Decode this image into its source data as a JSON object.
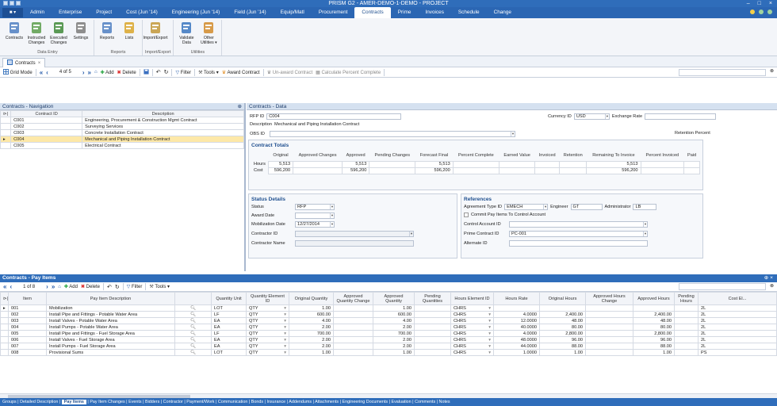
{
  "window": {
    "title": "PRISM G2 - AMER-DEMO-1-DEMO - PROJECT",
    "min": "–",
    "max": "□",
    "close": "×"
  },
  "menu": {
    "file_label": "■ ▾",
    "tabs": [
      "Admin",
      "Enterprise",
      "Project",
      "Cost (Jun '14)",
      "Engineering (Jun '14)",
      "Field (Jun '14)",
      "Equip/Matl",
      "Procurement",
      "Contracts",
      "Prime",
      "Invoices",
      "Schedule",
      "Change"
    ],
    "active_tab": "Contracts"
  },
  "ribbon": {
    "groups": [
      {
        "label": "Data Entry",
        "buttons": [
          "Contracts",
          "Instructed Changes",
          "Executed Changes",
          "Settings"
        ]
      },
      {
        "label": "Reports",
        "buttons": [
          "Reports",
          "Lists"
        ]
      },
      {
        "label": "Import/Export",
        "buttons": [
          "Import/Export"
        ]
      },
      {
        "label": "Utilities",
        "buttons": [
          "Validate Data",
          "Other Utilities ▾"
        ]
      }
    ]
  },
  "doc_tab": {
    "label": "Contracts",
    "close": "×"
  },
  "toolbar": {
    "grid_mode": "Grid Mode",
    "record": "4 of 5",
    "add": "Add",
    "delete": "Delete",
    "filter": "Filter",
    "tools": "Tools ▾",
    "award": "Award Contract",
    "unaward": "Un-award Contract",
    "calc": "Calculate Percent Complete"
  },
  "nav": {
    "title": "Contracts - Navigation",
    "pin": "⊕",
    "columns": [
      "Contract ID",
      "Description"
    ],
    "rows": [
      {
        "id": "C001",
        "desc": "Engineering, Procurement & Construction Mgmt Contract"
      },
      {
        "id": "C002",
        "desc": "Surveying Services"
      },
      {
        "id": "C003",
        "desc": "Concrete Installation Contract"
      },
      {
        "id": "C004",
        "desc": "Mechanical and Piping Installation Contract"
      },
      {
        "id": "C005",
        "desc": "Electrical Contract"
      }
    ],
    "selected_index": 3
  },
  "detail": {
    "title": "Contracts - Data",
    "rfp_label": "RFP ID",
    "rfp_value": "C004",
    "currency_label": "Currency ID",
    "currency_value": "USD",
    "exchange_label": "Exchange Rate",
    "description_label": "Description",
    "description_value": "Mechanical and Piping Installation Contract",
    "obs_label": "OBS ID",
    "retention_label": "Retention Percent",
    "totals": {
      "title": "Contract Totals",
      "columns": [
        "Original",
        "Approved Changes",
        "Approved",
        "Pending Changes",
        "Forecast Final",
        "Percent Complete",
        "Earned Value",
        "Invoiced",
        "Retention",
        "Remaining To Invoice",
        "Percent Invoiced",
        "Paid"
      ],
      "rows": [
        {
          "label": "Hours",
          "values": [
            "5,513",
            "",
            "5,513",
            "",
            "5,513",
            "",
            "",
            "",
            "",
            "5,513",
            "",
            ""
          ]
        },
        {
          "label": "Cost",
          "values": [
            "596,200",
            "",
            "596,200",
            "",
            "596,200",
            "",
            "",
            "",
            "",
            "596,200",
            "",
            ""
          ]
        }
      ]
    },
    "status": {
      "title": "Status Details",
      "status_label": "Status",
      "status_value": "RFP",
      "award_label": "Award Date",
      "mob_label": "Mobilization Date",
      "mob_value": "12/27/2014",
      "contractor_id_label": "Contractor ID",
      "contractor_name_label": "Contractor Name"
    },
    "references": {
      "title": "References",
      "agreement_label": "Agreement Type ID",
      "agreement_value": "EMECH",
      "engineer_label": "Engineer",
      "engineer_value": "GT",
      "admin_label": "Administrator",
      "admin_value": "LB",
      "commit_label": "Commit Pay Items To Control Account",
      "control_label": "Control Account ID",
      "prime_label": "Prime Contract ID",
      "prime_value": "PC-001",
      "alternate_label": "Alternate ID"
    }
  },
  "pay_items": {
    "title": "Contracts - Pay Items",
    "record": "1 of 8",
    "add": "Add",
    "delete": "Delete",
    "filter": "Filter",
    "tools": "Tools ▾",
    "columns": [
      "Item",
      "Pay Item Description",
      "Quantity Unit",
      "Quantity Element ID",
      "Original Quantity",
      "Approved Quantity Change",
      "Approved Quantity",
      "Pending Quantities",
      "Hours Element ID",
      "Hours Rate",
      "Original Hours",
      "Approved Hours Change",
      "Approved Hours",
      "Pending Hours",
      "Cost El..."
    ],
    "rows": [
      {
        "item": "001",
        "desc": "Mobilization",
        "unit": "LOT",
        "qel": "QTY",
        "oq": "1.00",
        "aqc": "",
        "aq": "1.00",
        "pq": "",
        "hel": "CHRS",
        "hr": "",
        "oh": "",
        "ahc": "",
        "ah": "",
        "ph": "",
        "cel": "2L"
      },
      {
        "item": "002",
        "desc": "Install Pipe and Fittings - Potable Water Area",
        "unit": "LF",
        "qel": "QTY",
        "oq": "600.00",
        "aqc": "",
        "aq": "600.00",
        "pq": "",
        "hel": "CHRS",
        "hr": "4.0000",
        "oh": "2,400.00",
        "ahc": "",
        "ah": "2,400.00",
        "ph": "",
        "cel": "2L"
      },
      {
        "item": "003",
        "desc": "Install Valves - Potable Water Area",
        "unit": "EA",
        "qel": "QTY",
        "oq": "4.00",
        "aqc": "",
        "aq": "4.00",
        "pq": "",
        "hel": "CHRS",
        "hr": "12.0000",
        "oh": "48.00",
        "ahc": "",
        "ah": "48.00",
        "ph": "",
        "cel": "2L"
      },
      {
        "item": "004",
        "desc": "Install Pumps - Potable Water Area",
        "unit": "EA",
        "qel": "QTY",
        "oq": "2.00",
        "aqc": "",
        "aq": "2.00",
        "pq": "",
        "hel": "CHRS",
        "hr": "40.0000",
        "oh": "80.00",
        "ahc": "",
        "ah": "80.00",
        "ph": "",
        "cel": "2L"
      },
      {
        "item": "005",
        "desc": "Install Pipe and Fittings - Fuel Storage Area",
        "unit": "LF",
        "qel": "QTY",
        "oq": "700.00",
        "aqc": "",
        "aq": "700.00",
        "pq": "",
        "hel": "CHRS",
        "hr": "4.0000",
        "oh": "2,800.00",
        "ahc": "",
        "ah": "2,800.00",
        "ph": "",
        "cel": "2L"
      },
      {
        "item": "006",
        "desc": "Install Valves - Fuel Storage Area",
        "unit": "EA",
        "qel": "QTY",
        "oq": "2.00",
        "aqc": "",
        "aq": "2.00",
        "pq": "",
        "hel": "CHRS",
        "hr": "48.0000",
        "oh": "96.00",
        "ahc": "",
        "ah": "96.00",
        "ph": "",
        "cel": "2L"
      },
      {
        "item": "007",
        "desc": "Install Pumps - Fuel Storage Area",
        "unit": "EA",
        "qel": "QTY",
        "oq": "2.00",
        "aqc": "",
        "aq": "2.00",
        "pq": "",
        "hel": "CHRS",
        "hr": "44.0000",
        "oh": "88.00",
        "ahc": "",
        "ah": "88.00",
        "ph": "",
        "cel": "2L"
      },
      {
        "item": "008",
        "desc": "Provisional Sums",
        "unit": "LOT",
        "qel": "QTY",
        "oq": "1.00",
        "aqc": "",
        "aq": "1.00",
        "pq": "",
        "hel": "CHRS",
        "hr": "1.0000",
        "oh": "1.00",
        "ahc": "",
        "ah": "1.00",
        "ph": "",
        "cel": "PS"
      }
    ]
  },
  "bottom_tabs": [
    "Groups",
    "Detailed Description",
    "Pay Items",
    "Pay Item Changes",
    "Events",
    "Bidders",
    "Contractor",
    "Payment/Work",
    "Communication",
    "Bonds",
    "Insurance",
    "Addendums",
    "Attachments",
    "Engineering Documents",
    "Evaluation",
    "Comments",
    "Notes"
  ],
  "bottom_active": "Pay Items",
  "colors": {
    "accent": "#2f6dba",
    "selected_row": "#fde8a8",
    "header_bg": "#d5e1f0"
  }
}
